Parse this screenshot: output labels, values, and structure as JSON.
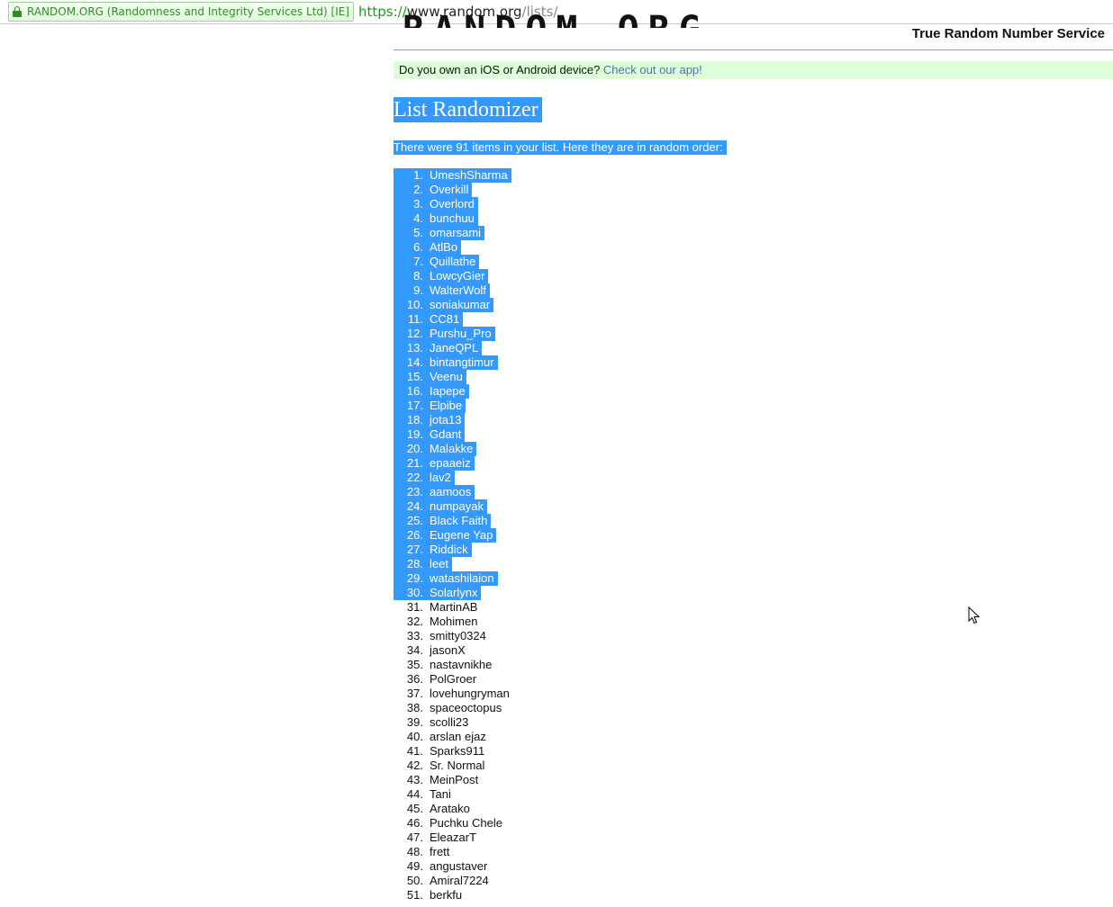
{
  "browser": {
    "cert_label": "RANDOM.ORG (Randomness and Integrity Services Ltd) [IE]",
    "url_scheme": "https://",
    "url_host": "www.random.org",
    "url_path": "/lists/"
  },
  "header": {
    "logo_text": "RANDOM.ORG",
    "tagline": "True Random Number Service"
  },
  "promo": {
    "text": "Do you own an iOS or Android device? ",
    "link": "Check out our app!"
  },
  "main": {
    "title": "List Randomizer",
    "summary": "There were 91 items in your list. Here they are in random order:"
  },
  "list": {
    "selected_through": 30,
    "items": [
      "UmeshSharma",
      "Overkill",
      "Overlord",
      "bunchuu",
      "omarsami",
      "AtlBo",
      "Quillathe",
      "LowcyGier",
      "WalterWolf",
      "soniakumar",
      "CC81",
      "Purshu_Pro",
      "JaneQPL",
      "bintangtimur",
      "Veenu",
      "Iapepe",
      "Elpibe",
      "jota13",
      "Gdant",
      "Malakke",
      "epaaeiz",
      "lav2",
      "aamoos",
      "numpayak",
      "Black Faith",
      "Eugene Yap",
      "Riddick",
      "leet",
      "watashilaion",
      "Solarlynx",
      "MartinAB",
      "Mohimen",
      "smitty0324",
      "jasonX",
      "nastavnikhe",
      "PolGroer",
      "lovehungryman",
      "spaceoctopus",
      "scolli23",
      "arslan ejaz",
      "Sparks911",
      "Sr. Normal",
      "MeinPost",
      "Tani",
      "Aratako",
      "Puchku Chele",
      "EleazarT",
      "frett",
      "angustaver",
      "Amiral7224",
      "berkfu"
    ]
  },
  "colors": {
    "selection": "#3399ff",
    "promo_bg": "#dcffd9",
    "link": "#4e6fb1",
    "secure_green": "#2d8f22"
  }
}
